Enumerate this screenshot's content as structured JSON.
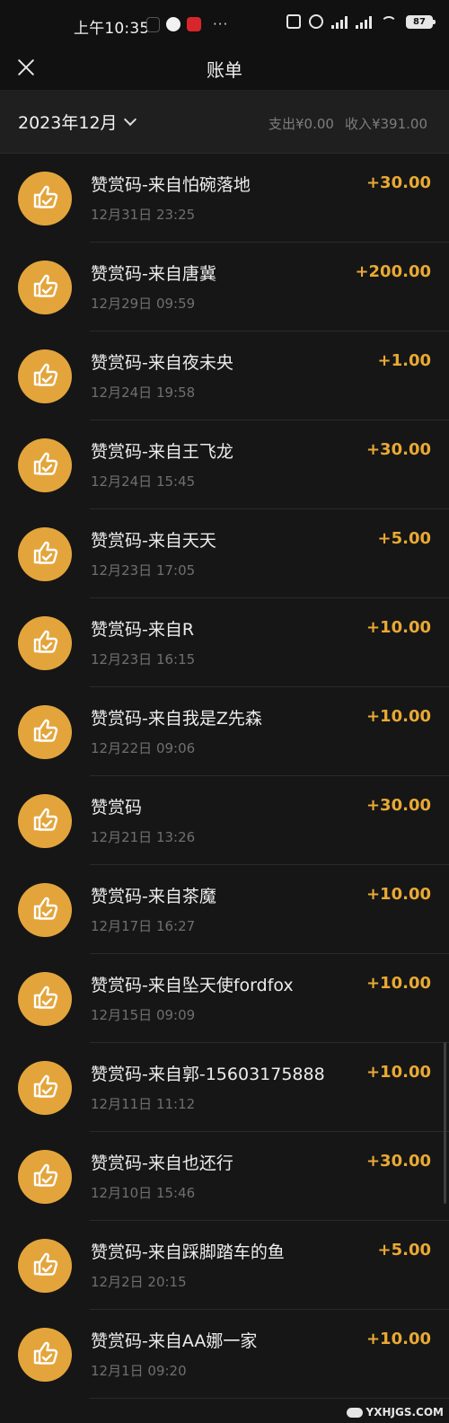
{
  "status_bar": {
    "time": "上午10:35",
    "more": "···",
    "battery": "87",
    "apps": [
      "tiktok-icon",
      "qq-icon",
      "news-icon"
    ]
  },
  "header": {
    "title": "账单",
    "close_icon": "close-icon"
  },
  "filter": {
    "month": "2023年12月",
    "expense": "支出¥0.00",
    "income": "收入¥391.00"
  },
  "colors": {
    "background": "#161616",
    "avatar": "#e3a53b",
    "amount": "#e9a934"
  },
  "transactions": [
    {
      "title": "赞赏码-来自怕碗落地",
      "time": "12月31日 23:25",
      "amount": "+30.00"
    },
    {
      "title": "赞赏码-来自唐冀",
      "time": "12月29日 09:59",
      "amount": "+200.00"
    },
    {
      "title": "赞赏码-来自夜未央",
      "time": "12月24日 19:58",
      "amount": "+1.00"
    },
    {
      "title": "赞赏码-来自王飞龙",
      "time": "12月24日 15:45",
      "amount": "+30.00"
    },
    {
      "title": "赞赏码-来自天天",
      "time": "12月23日 17:05",
      "amount": "+5.00"
    },
    {
      "title": "赞赏码-来自R",
      "time": "12月23日 16:15",
      "amount": "+10.00"
    },
    {
      "title": "赞赏码-来自我是Z先森",
      "time": "12月22日 09:06",
      "amount": "+10.00"
    },
    {
      "title": "赞赏码",
      "time": "12月21日 13:26",
      "amount": "+30.00"
    },
    {
      "title": "赞赏码-来自茶魔",
      "time": "12月17日 16:27",
      "amount": "+10.00"
    },
    {
      "title": "赞赏码-来自坠天使fordfox",
      "time": "12月15日 09:09",
      "amount": "+10.00"
    },
    {
      "title": "赞赏码-来自郭-15603175888",
      "time": "12月11日 11:12",
      "amount": "+10.00"
    },
    {
      "title": "赞赏码-来自也还行",
      "time": "12月10日 15:46",
      "amount": "+30.00"
    },
    {
      "title": "赞赏码-来自踩脚踏车的鱼",
      "time": "12月2日 20:15",
      "amount": "+5.00"
    },
    {
      "title": "赞赏码-来自AA娜一家",
      "time": "12月1日 09:20",
      "amount": "+10.00"
    }
  ],
  "watermark": "YXHJGS.COM"
}
